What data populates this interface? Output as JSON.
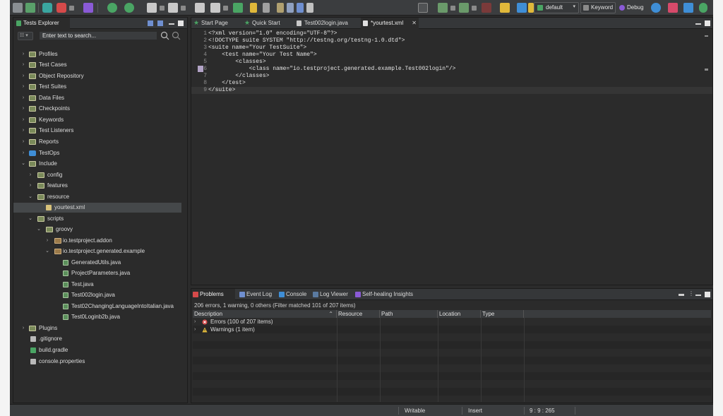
{
  "toolbar": {
    "profile_select": "default",
    "keyword_button": "Keyword",
    "debug_button": "Debug",
    "icons": [
      "new-icon",
      "save-icon",
      "git-icon",
      "git-branch-icon",
      "spy-icon",
      "record-web-icon",
      "record-mobile-icon",
      "new-test-case-icon",
      "run-icon",
      "stop-icon",
      "terminal-icon"
    ],
    "colors": {
      "accent_green": "#4aa564",
      "error_red": "#d64a4a",
      "warning_yellow": "#e0b83a"
    }
  },
  "left_panel": {
    "tab_title": "Tests Explorer",
    "filter_placeholder": "Enter text to search...",
    "tree": [
      {
        "label": "Profiles",
        "icon": "folder-icon"
      },
      {
        "label": "Test Cases",
        "icon": "folder-icon"
      },
      {
        "label": "Object Repository",
        "icon": "folder-icon"
      },
      {
        "label": "Test Suites",
        "icon": "folder-icon"
      },
      {
        "label": "Data Files",
        "icon": "folder-icon"
      },
      {
        "label": "Checkpoints",
        "icon": "folder-icon"
      },
      {
        "label": "Keywords",
        "icon": "folder-icon"
      },
      {
        "label": "Test Listeners",
        "icon": "folder-icon"
      },
      {
        "label": "Reports",
        "icon": "folder-icon"
      },
      {
        "label": "TestOps",
        "icon": "testops-icon"
      },
      {
        "label": "Include",
        "icon": "folder-icon"
      },
      {
        "label": "config",
        "icon": "folder-icon"
      },
      {
        "label": "features",
        "icon": "folder-icon"
      },
      {
        "label": "resource",
        "icon": "folder-icon"
      },
      {
        "label": "yourtest.xml",
        "icon": "xml-file-icon"
      },
      {
        "label": "scripts",
        "icon": "folder-icon"
      },
      {
        "label": "groovy",
        "icon": "folder-icon"
      },
      {
        "label": "io.testproject.addon",
        "icon": "package-icon"
      },
      {
        "label": "io.testproject.generated.example",
        "icon": "package-icon"
      },
      {
        "label": "GeneratedUtils.java",
        "icon": "java-file-icon"
      },
      {
        "label": "ProjectParameters.java",
        "icon": "java-file-icon"
      },
      {
        "label": "Test.java",
        "icon": "java-file-icon"
      },
      {
        "label": "Test002login.java",
        "icon": "java-file-icon"
      },
      {
        "label": "Test02ChangingLanguageIntoItalian.java",
        "icon": "java-file-icon"
      },
      {
        "label": "Test0Loginb2b.java",
        "icon": "java-file-icon"
      },
      {
        "label": "Plugins",
        "icon": "folder-icon"
      },
      {
        "label": ".gitignore",
        "icon": "file-icon"
      },
      {
        "label": "build.gradle",
        "icon": "file-icon"
      },
      {
        "label": "console.properties",
        "icon": "file-icon"
      }
    ]
  },
  "editor": {
    "tabs": [
      {
        "label": "Start Page",
        "icon": "star-icon"
      },
      {
        "label": "Quick Start",
        "icon": "star-icon"
      },
      {
        "label": "Test002login.java",
        "icon": "java-file-icon"
      },
      {
        "label": "*yourtest.xml",
        "icon": "xml-file-icon",
        "active": true
      }
    ],
    "lines": [
      {
        "num": "1",
        "text": "<?xml version=\"1.0\" encoding=\"UTF-8\"?>"
      },
      {
        "num": "2",
        "text": "<!DOCTYPE suite SYSTEM \"http://testng.org/testng-1.0.dtd\">"
      },
      {
        "num": "3",
        "text": "<suite name=\"Your TestSuite\">"
      },
      {
        "num": "4",
        "text": "    <test name=\"Your Test Name\">"
      },
      {
        "num": "5",
        "text": "        <classes>"
      },
      {
        "num": "6",
        "text": "            <class name=\"io.testproject.generated.example.Test002login\"/>"
      },
      {
        "num": "7",
        "text": "        </classes>"
      },
      {
        "num": "8",
        "text": "    </test>"
      },
      {
        "num": "9",
        "text": "</suite>"
      }
    ]
  },
  "bottom_panel": {
    "tabs": [
      {
        "label": "Problems",
        "icon": "problems-icon",
        "active": true
      },
      {
        "label": "Event Log",
        "icon": "event-log-icon"
      },
      {
        "label": "Console",
        "icon": "console-icon"
      },
      {
        "label": "Log Viewer",
        "icon": "log-viewer-icon"
      },
      {
        "label": "Self-healing Insights",
        "icon": "self-healing-icon"
      }
    ],
    "summary": "206 errors, 1 warning, 0 others (Filter matched 101 of 207 items)",
    "columns": [
      "Description",
      "Resource",
      "Path",
      "Location",
      "Type"
    ],
    "rows": [
      {
        "label": "Errors (100 of 207 items)",
        "icon": "error-icon"
      },
      {
        "label": "Warnings (1 item)",
        "icon": "warning-icon"
      }
    ]
  },
  "statusbar": {
    "mode": "Writable",
    "insert": "Insert",
    "position": "9 : 9 : 265"
  }
}
